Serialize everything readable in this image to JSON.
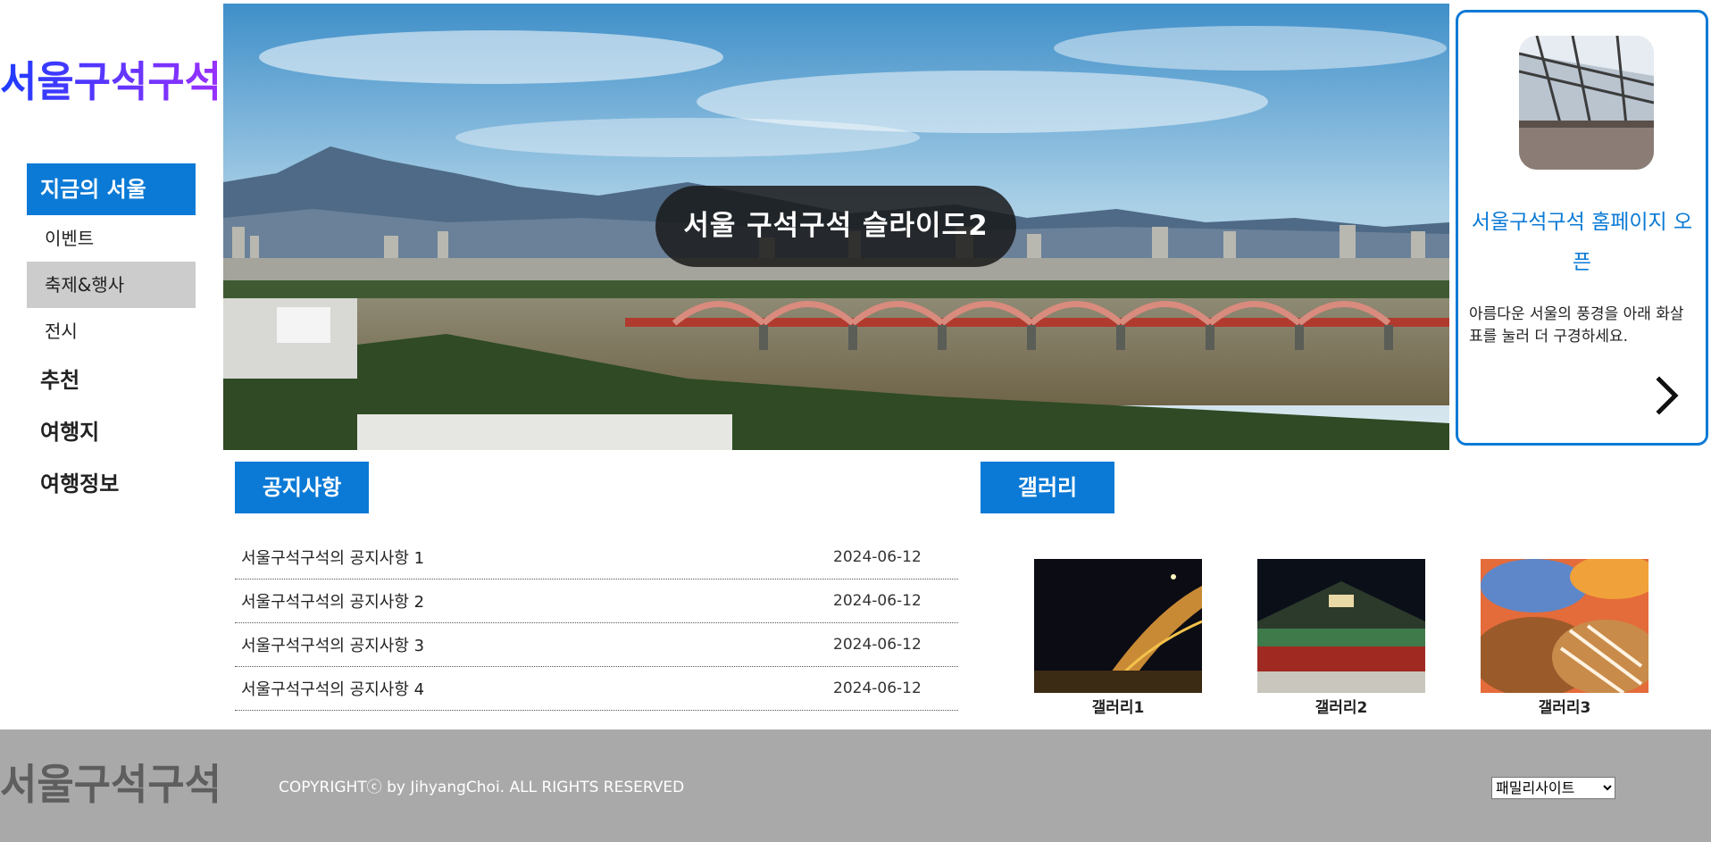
{
  "brand": {
    "logo_text": "서울구석구석",
    "logo_colors": [
      "#1e3cff",
      "#8a2be2"
    ],
    "accent": "#0b7ad6"
  },
  "nav": {
    "items": [
      {
        "label": "지금의 서울",
        "active": true
      },
      {
        "label": "이벤트"
      },
      {
        "label": "축제&행사",
        "hover": true
      },
      {
        "label": "전시"
      },
      {
        "label": "추천"
      },
      {
        "label": "여행지"
      },
      {
        "label": "여행정보"
      }
    ]
  },
  "hero": {
    "caption": "서울 구석구석 슬라이드2",
    "image": "seoul-han-river-bridge-photo"
  },
  "promo": {
    "title": "서울구석구석 홈페이지 오픈",
    "description": "아름다운 서울의 풍경을 아래 화살표를 눌러 더 구경하세요.",
    "image": "train-station-photo",
    "arrow_icon": "chevron-right-icon"
  },
  "notice": {
    "title": "공지사항",
    "items": [
      {
        "text": "서울구석구석의 공지사항 1",
        "date": "2024-06-12"
      },
      {
        "text": "서울구석구석의 공지사항 2",
        "date": "2024-06-12"
      },
      {
        "text": "서울구석구석의 공지사항 3",
        "date": "2024-06-12"
      },
      {
        "text": "서울구석구석의 공지사항 4",
        "date": "2024-06-12"
      }
    ]
  },
  "gallery": {
    "title": "갤러리",
    "items": [
      {
        "label": "갤러리1",
        "image": "night-bridge-photo"
      },
      {
        "label": "갤러리2",
        "image": "palace-gate-photo"
      },
      {
        "label": "갤러리3",
        "image": "pastry-photo"
      }
    ]
  },
  "footer": {
    "logo_text": "서울구석구석",
    "copyright": "COPYRIGHTⓒ by JihyangChoi. ALL RIGHTS RESERVED",
    "family_select": {
      "selected": "패밀리사이트"
    }
  }
}
